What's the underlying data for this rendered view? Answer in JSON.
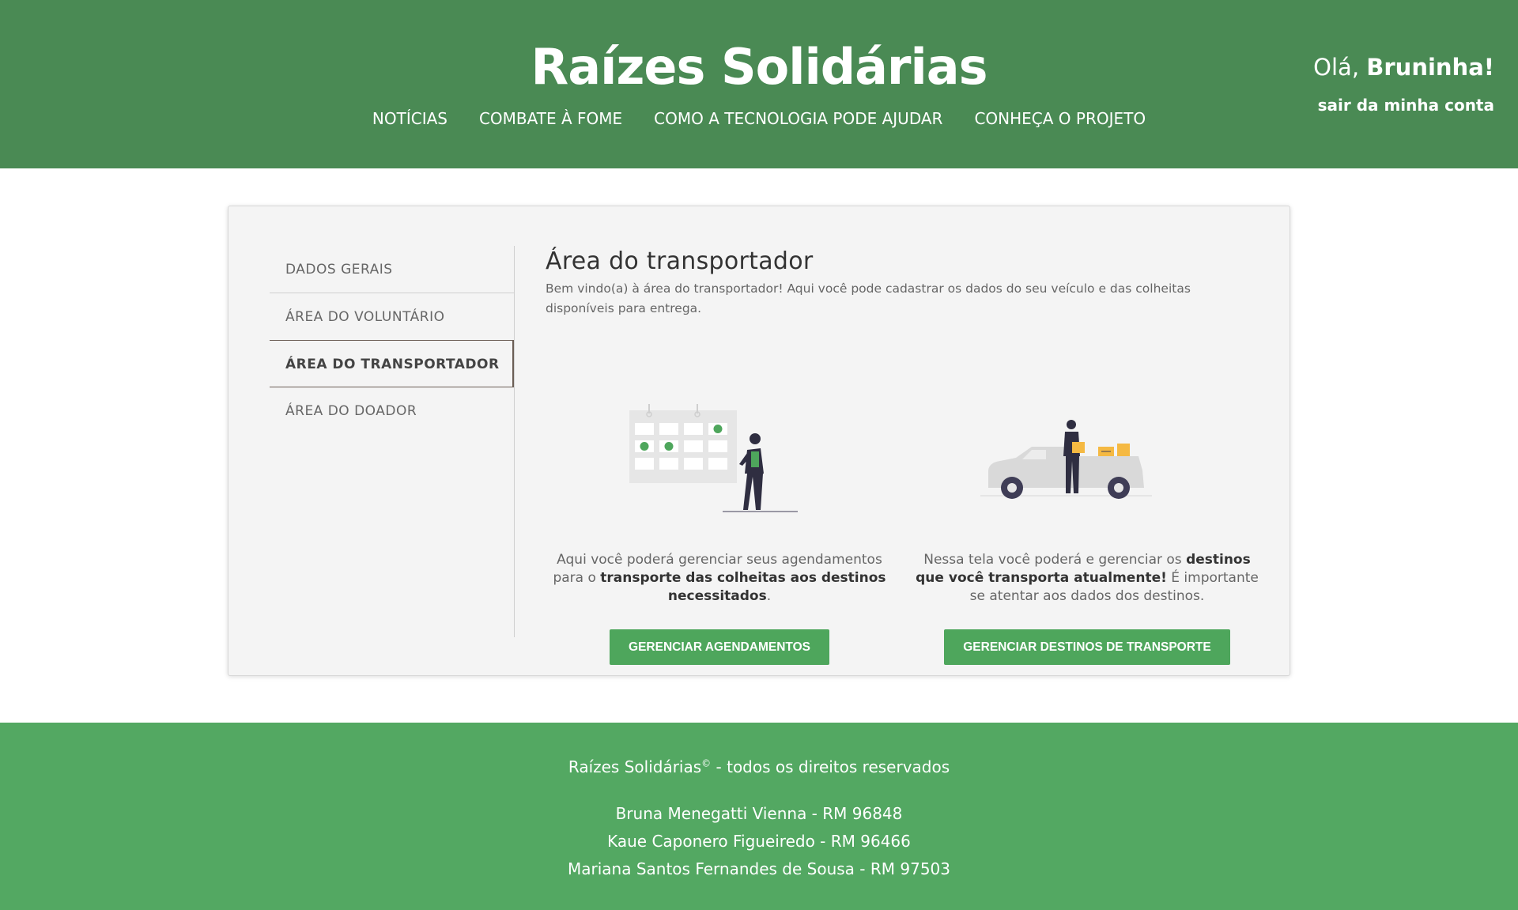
{
  "header": {
    "brand": "Raízes Solidárias",
    "nav": [
      "NOTÍCIAS",
      "COMBATE À FOME",
      "COMO A TECNOLOGIA PODE AJUDAR",
      "CONHEÇA O PROJETO"
    ],
    "greeting_prefix": "Olá, ",
    "user_name": "Bruninha!",
    "logout": "sair da minha conta"
  },
  "sidebar": {
    "items": [
      {
        "label": "DADOS GERAIS",
        "active": false
      },
      {
        "label": "ÁREA DO VOLUNTÁRIO",
        "active": false
      },
      {
        "label": "ÁREA DO TRANSPORTADOR",
        "active": true
      },
      {
        "label": "ÁREA DO DOADOR",
        "active": false
      }
    ]
  },
  "main": {
    "title": "Área do transportador",
    "intro": "Bem vindo(a) à área do transportador! Aqui você pode cadastrar os dados do seu veículo e das colheitas disponíveis para entrega.",
    "left": {
      "text_1": "Aqui você poderá gerenciar seus agendamentos para o ",
      "bold": "transporte das colheitas aos destinos necessitados",
      "text_2": ".",
      "button": "GERENCIAR AGENDAMENTOS"
    },
    "right": {
      "text_1": "Nessa tela você poderá e gerenciar os ",
      "bold": "destinos que você transporta atualmente!",
      "text_2": " É importante se atentar aos dados dos destinos.",
      "button": "GERENCIAR DESTINOS DE TRANSPORTE"
    }
  },
  "footer": {
    "copyright_brand": "Raízes Solidárias",
    "copyright_symbol": "©",
    "copyright_text": " - todos os direitos reservados",
    "authors": [
      "Bruna Menegatti Vienna - RM 96848",
      "Kaue Caponero Figueiredo - RM 96466",
      "Mariana Santos Fernandes de Sousa - RM 97503"
    ]
  },
  "colors": {
    "header_bg": "#4a8a54",
    "footer_bg": "#53a862",
    "button_bg": "#4ea65c",
    "accent_yellow": "#f5b942"
  },
  "icons": [
    "calendar-illustration",
    "delivery-truck-illustration"
  ]
}
